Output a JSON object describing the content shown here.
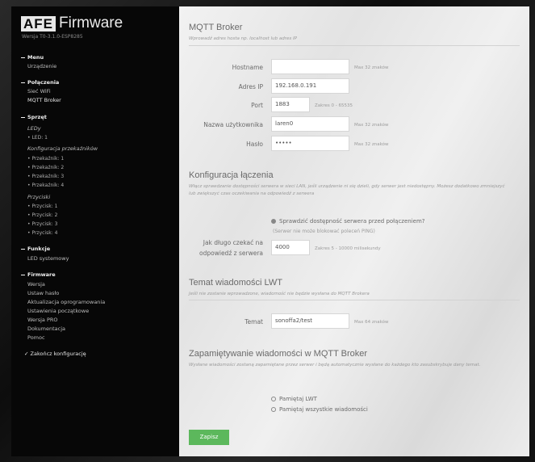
{
  "sidebar": {
    "logo": "AFE",
    "brand_word": "Firmware",
    "version": "Wersja T0-3.1.0-ESP8285",
    "menu_header": "Menu",
    "menu_items": [
      "Urządzenie"
    ],
    "connections_header": "Połączenia",
    "connection_items": [
      "Sieć WiFi",
      "MQTT Broker"
    ],
    "hardware_header": "Sprzęt",
    "leds_label": "LEDy",
    "led_items": [
      "LED: 1"
    ],
    "relays_label": "Konfiguracja przekaźników",
    "relay_items": [
      "Przekaźnik: 1",
      "Przekaźnik: 2",
      "Przekaźnik: 3",
      "Przekaźnik: 4"
    ],
    "switches_label": "Przyciski",
    "switch_items": [
      "Przycisk: 1",
      "Przycisk: 2",
      "Przycisk: 3",
      "Przycisk: 4"
    ],
    "functions_header": "Funkcje",
    "function_items": [
      "LED systemowy"
    ],
    "firmware_header": "Firmware",
    "firmware_items": [
      "Wersja",
      "Ustaw hasło",
      "Aktualizacja oprogramowania",
      "Ustawienia początkowe",
      "Wersja PRO",
      "Dokumentacja",
      "Pomoc"
    ],
    "finish": "Zakończ konfigurację"
  },
  "mqtt": {
    "title": "MQTT Broker",
    "desc": "Wprowadź adres hosta np. localhost lub adres IP",
    "hostname_label": "Hostname",
    "hostname_value": "",
    "hostname_hint": "Max 32 znaków",
    "ip_label": "Adres IP",
    "ip_value": "192.168.0.191",
    "port_label": "Port",
    "port_value": "1883",
    "port_hint": "Zakres 0 - 65535",
    "user_label": "Nazwa użytkownika",
    "user_value": "laren0",
    "user_hint": "Max 32 znaków",
    "pass_label": "Hasło",
    "pass_value": "•••••",
    "pass_hint": "Max 32 znaków"
  },
  "conn": {
    "title": "Konfiguracja łączenia",
    "desc": "Włącz sprawdzanie dostępności serwera w sieci LAN, jeśli urządzenie ni się dzieli, gdy serwer jest niedostępny. Możesz dodatkowo zmniejszyć lub zwiększyć czas oczekiwania na odpowiedź z serwera",
    "check_label": "Sprawdzić dostępność serwera przed połączeniem?",
    "check_note": "(Serwer nie może blokować poleceń PING)",
    "wait_label": "Jak długo czekać na odpowiedź z serwera",
    "wait_value": "4000",
    "wait_hint": "Zakres 5 - 10000 milisekundy"
  },
  "lwt": {
    "title": "Temat wiadomości LWT",
    "desc": "Jeśli nie zostanie wprowadzone, wiadomość nie będzie wysłana do MQTT Brokera",
    "topic_label": "Temat",
    "topic_value": "sonoffa2/test",
    "topic_hint": "Max 64 znaków"
  },
  "retain": {
    "title": "Zapamiętywanie wiadomości w MQTT Broker",
    "desc": "Wysłane wiadomości zostaną zapamiętane przez serwer i będą automatycznie wysłane do każdego kto zasubskrybuje dany temat.",
    "opt1": "Pamiętaj LWT",
    "opt2": "Pamiętaj wszystkie wiadomości"
  },
  "save_label": "Zapisz"
}
